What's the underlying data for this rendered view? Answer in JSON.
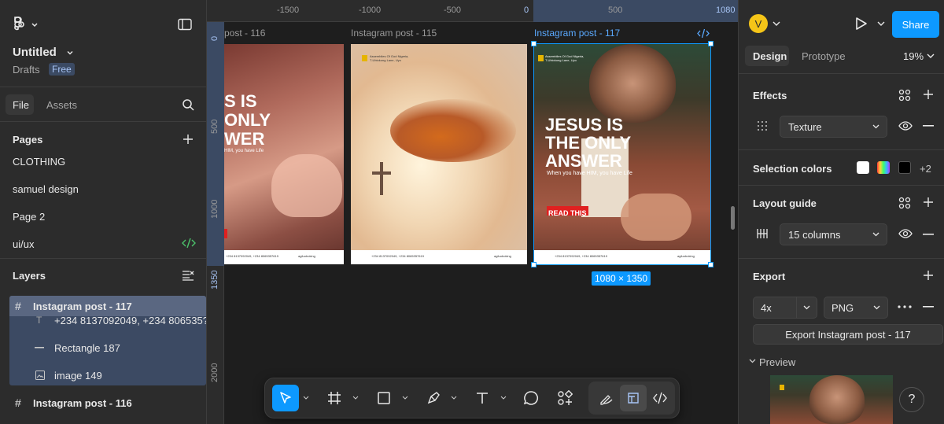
{
  "file": {
    "name": "Untitled",
    "location": "Drafts",
    "plan_badge": "Free"
  },
  "left_tabs": {
    "file": "File",
    "assets": "Assets"
  },
  "pages": {
    "heading": "Pages",
    "items": [
      {
        "label": "CLOTHING"
      },
      {
        "label": "samuel design"
      },
      {
        "label": "Page 2"
      },
      {
        "label": "ui/ux"
      }
    ]
  },
  "layers": {
    "heading": "Layers",
    "items": [
      {
        "label": "Instagram post - 117",
        "type": "frame"
      },
      {
        "label": "+234 8137092049, +234 806535?",
        "type": "text"
      },
      {
        "label": "Rectangle 187",
        "type": "rectangle"
      },
      {
        "label": "image 149",
        "type": "image"
      },
      {
        "label": "Instagram post - 116",
        "type": "frame"
      }
    ]
  },
  "ruler": {
    "top": [
      "-1500",
      "-1000",
      "-500",
      "0",
      "500",
      "1080"
    ],
    "left": [
      "0",
      "500",
      "1000",
      "1350",
      "2000"
    ]
  },
  "frames": [
    {
      "title": "post - 116"
    },
    {
      "title": "Instagram post - 115"
    },
    {
      "title": "Instagram post - 117"
    }
  ],
  "poster": {
    "org": "Assemblies Of God Nigeria,\nT-Ubiokong Lane, Uyo",
    "headline_1": "JESUS IS",
    "headline_2": "THE ONLY",
    "headline_3": "ANSWER",
    "sub": "When you have HIM, you have Life",
    "cta": "READ THIS",
    "left_h1": "S IS",
    "left_h2": "ONLY",
    "left_h3": "WER",
    "left_sub": "HIM, you have Life",
    "footer_phone": "+234 8137092049, +234 8065357619",
    "footer_handle": "agfuoboking"
  },
  "selection_size": "1080 × 1350",
  "right": {
    "avatar_initial": "V",
    "share_label": "Share",
    "tabs": {
      "design": "Design",
      "prototype": "Prototype"
    },
    "zoom": "19%",
    "effects_heading": "Effects",
    "effect_value": "Texture",
    "selection_colors_heading": "Selection colors",
    "selection_colors_more": "+2",
    "layout_guide_heading": "Layout guide",
    "layout_guide_value": "15 columns",
    "export_heading": "Export",
    "export_scale": "4x",
    "export_format": "PNG",
    "export_button": "Export Instagram post - 117",
    "preview_label": "Preview",
    "help": "?"
  },
  "colors": {
    "accent": "#0d99ff",
    "panel": "#2c2c2c",
    "canvas": "#1e1e1e",
    "avatar": "#f5c518"
  }
}
